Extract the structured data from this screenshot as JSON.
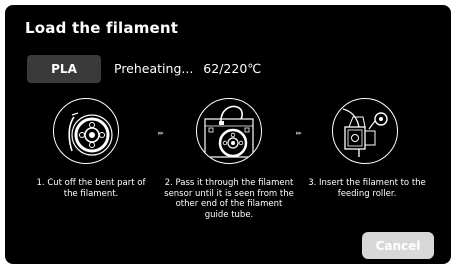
{
  "header": {
    "title": "Load the filament"
  },
  "material": {
    "label": "PLA"
  },
  "status": {
    "text": "Preheating...",
    "temperature": "62/220℃"
  },
  "steps": [
    {
      "icon": "spool-icon",
      "caption_line1": "1. Cut off the bent part  of",
      "caption_line2": "the filament."
    },
    {
      "icon": "printer-spool-icon",
      "caption_line1": "2. Pass it through the filament",
      "caption_line2": "sensor until it is seen from the",
      "caption_line3": "other end of the filament",
      "caption_line4": "guide tube."
    },
    {
      "icon": "extruder-icon",
      "caption_line1": "3. Insert the filament to the",
      "caption_line2": "feeding roller."
    }
  ],
  "arrows": {
    "glyph": "▸▸"
  },
  "actions": {
    "cancel_label": "Cancel"
  },
  "colors": {
    "background": "#000000",
    "material_button": "#3a3a3a",
    "cancel_button": "#d8d8d8"
  }
}
